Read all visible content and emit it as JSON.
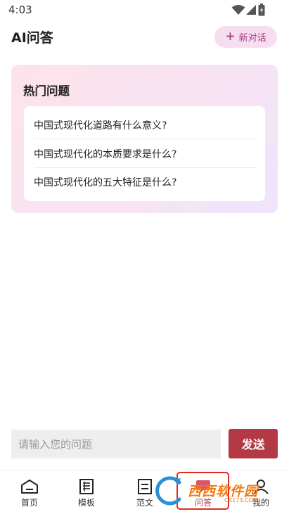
{
  "status_bar": {
    "time": "4:03"
  },
  "header": {
    "title": "AI问答",
    "new_chat_label": "新对话"
  },
  "hot_questions": {
    "title": "热门问题",
    "items": [
      "中国式现代化道路有什么意义?",
      "中国式现代化的本质要求是什么?",
      "中国式现代化的五大特征是什么?"
    ]
  },
  "input": {
    "placeholder": "请输入您的问题",
    "send_label": "发送"
  },
  "nav": {
    "items": [
      {
        "label": "首页",
        "icon": "home-icon"
      },
      {
        "label": "模板",
        "icon": "template-icon"
      },
      {
        "label": "范文",
        "icon": "sample-essay-icon"
      },
      {
        "label": "问答",
        "icon": "qa-icon"
      },
      {
        "label": "我的",
        "icon": "profile-icon"
      }
    ],
    "active": "问答"
  },
  "watermark": {
    "text": "西西软件园",
    "sub": "CR173.COM"
  },
  "colors": {
    "accent": "#b33a45",
    "new_chat_bg": "#f7deef",
    "new_chat_text": "#a33b86"
  }
}
